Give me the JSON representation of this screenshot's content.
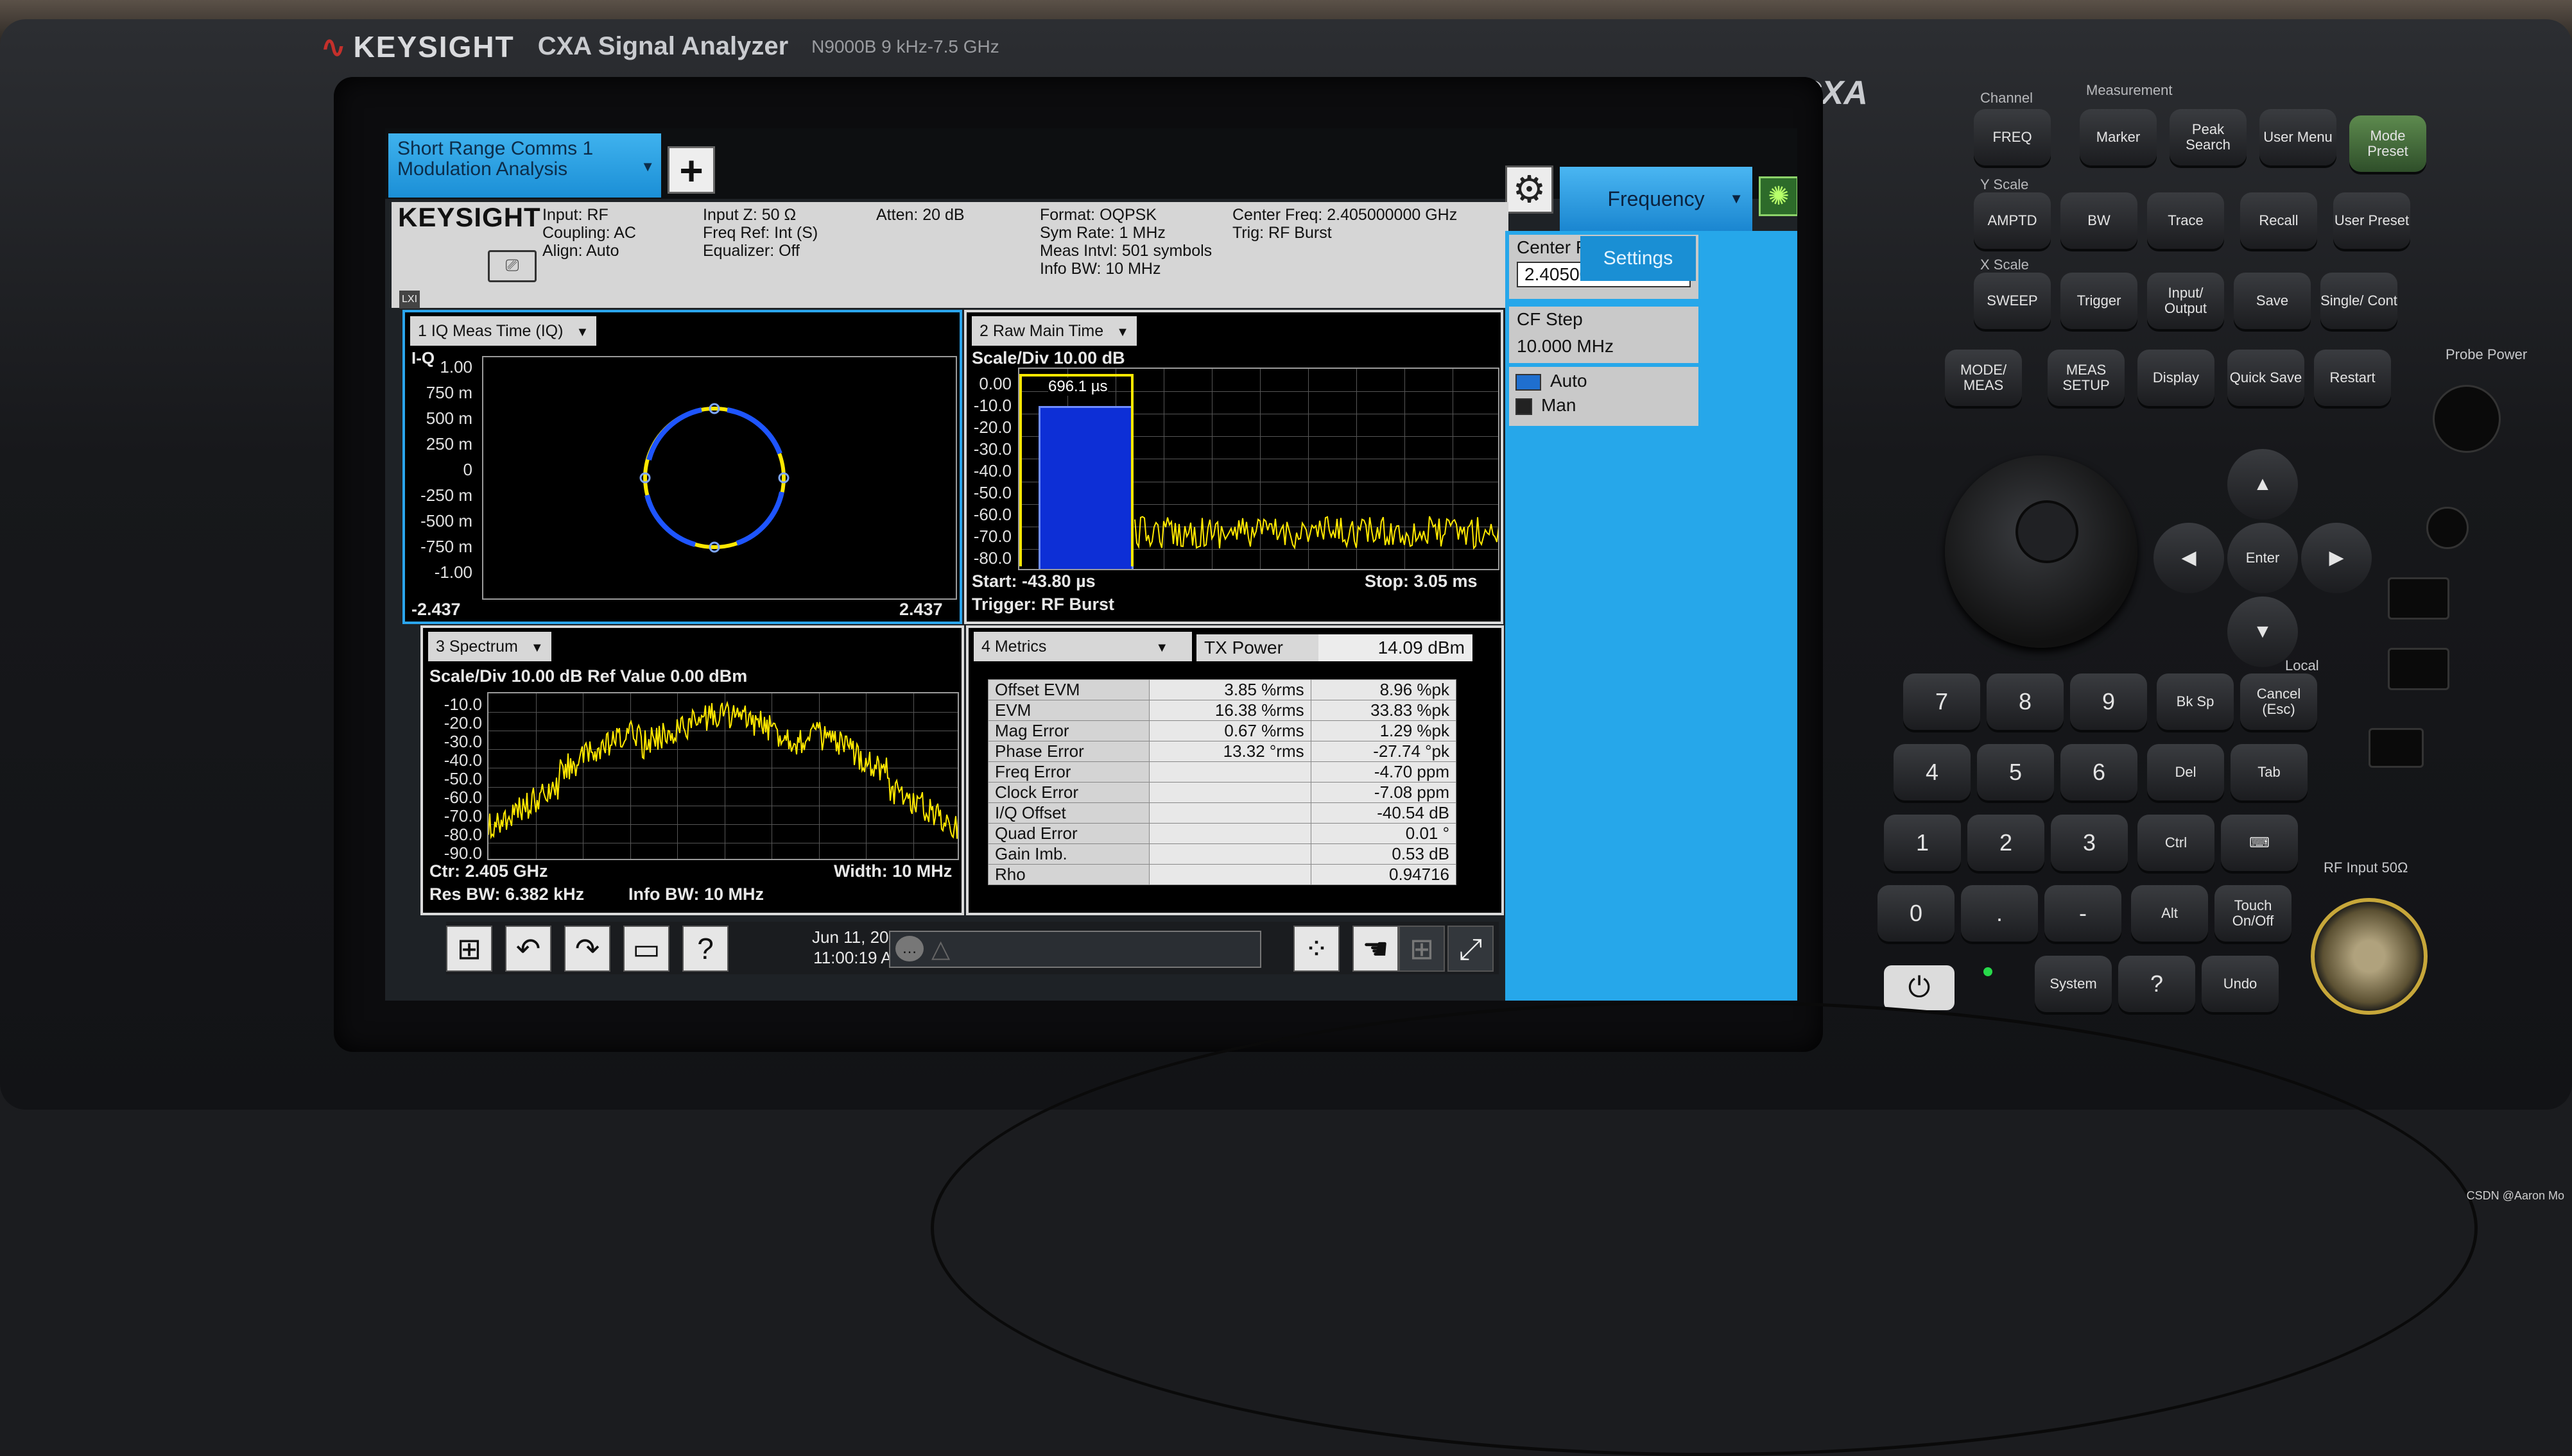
{
  "device": {
    "brand": "KEYSIGHT",
    "product": "CXA Signal Analyzer",
    "model_range": "N9000B 9 kHz-7.5 GHz",
    "model_short": "CXA"
  },
  "screen": {
    "mode_tab": {
      "line1": "Short Range Comms 1",
      "line2": "Modulation Analysis"
    },
    "add_tab": "+",
    "infobar": {
      "logo": "KEYSIGHT",
      "lxi": "LXI",
      "col1": [
        "Input: RF",
        "Coupling: AC",
        "Align: Auto"
      ],
      "col2": [
        "Input Z: 50 Ω",
        "Freq Ref: Int (S)",
        "Equalizer: Off"
      ],
      "col3": [
        "Atten: 20 dB"
      ],
      "col4": [
        "Format: OQPSK",
        "Sym Rate: 1 MHz",
        "Meas Intvl: 501 symbols",
        "Info BW: 10 MHz"
      ],
      "col5": [
        "Center Freq: 2.405000000 GHz",
        "Trig: RF Burst"
      ]
    },
    "panel1": {
      "title": "1 IQ Meas Time (IQ)",
      "axis_label": "I-Q",
      "y_ticks": [
        "1.00",
        "750 m",
        "500 m",
        "250 m",
        "0",
        "-250 m",
        "-500 m",
        "-750 m",
        "-1.00"
      ],
      "x_min": "-2.437",
      "x_max": "2.437"
    },
    "panel2": {
      "title": "2 Raw Main Time",
      "scale": "Scale/Div 10.00 dB",
      "y_ticks": [
        "0.00",
        "-10.0",
        "-20.0",
        "-30.0",
        "-40.0",
        "-50.0",
        "-60.0",
        "-70.0",
        "-80.0"
      ],
      "marker": "696.1 µs",
      "start": "Start: -43.80 µs",
      "stop": "Stop: 3.05 ms",
      "trigger": "Trigger: RF Burst"
    },
    "panel3": {
      "title": "3 Spectrum",
      "scale": "Scale/Div 10.00 dB Ref Value 0.00 dBm",
      "y_ticks": [
        "-10.0",
        "-20.0",
        "-30.0",
        "-40.0",
        "-50.0",
        "-60.0",
        "-70.0",
        "-80.0",
        "-90.0"
      ],
      "ctr": "Ctr: 2.405 GHz",
      "width": "Width: 10 MHz",
      "res_bw": "Res BW: 6.382 kHz",
      "info_bw": "Info BW: 10 MHz"
    },
    "panel4": {
      "title": "4 Metrics",
      "tx_power_label": "TX Power",
      "tx_power_value": "14.09 dBm",
      "rows": [
        {
          "label": "Offset EVM",
          "rms": "3.85 %rms",
          "pk": "8.96 %pk"
        },
        {
          "label": "EVM",
          "rms": "16.38 %rms",
          "pk": "33.83 %pk"
        },
        {
          "label": "Mag Error",
          "rms": "0.67 %rms",
          "pk": "1.29 %pk"
        },
        {
          "label": "Phase Error",
          "rms": "13.32 °rms",
          "pk": "-27.74 °pk"
        },
        {
          "label": "Freq Error",
          "rms": "",
          "pk": "-4.70 ppm"
        },
        {
          "label": "Clock Error",
          "rms": "",
          "pk": "-7.08 ppm"
        },
        {
          "label": "I/Q Offset",
          "rms": "",
          "pk": "-40.54 dB"
        },
        {
          "label": "Quad Error",
          "rms": "",
          "pk": "0.01 °"
        },
        {
          "label": "Gain Imb.",
          "rms": "",
          "pk": "0.53 dB"
        },
        {
          "label": "Rho",
          "rms": "",
          "pk": "0.94716"
        }
      ]
    },
    "side": {
      "menu": "Frequency",
      "settings_tab": "Settings",
      "center_freq_label": "Center Frequency",
      "center_freq_value": "2.405000000 GHz",
      "cf_step_label": "CF Step",
      "cf_step_value": "10.000 MHz",
      "auto": "Auto",
      "man": "Man"
    },
    "taskbar": {
      "date": "Jun 11, 2020",
      "time": "11:00:19 AM"
    }
  },
  "keys": {
    "channel_label": "Channel",
    "measurement_label": "Measurement",
    "yscale_label": "Y Scale",
    "xscale_label": "X Scale",
    "local_label": "Local",
    "probe_label": "Probe Power",
    "rf_input_label": "RF Input 50Ω",
    "freq": "FREQ",
    "marker": "Marker",
    "peak_search": "Peak Search",
    "user_menu": "User Menu",
    "mode_preset": "Mode Preset",
    "amptd": "AMPTD",
    "bw": "BW",
    "trace": "Trace",
    "recall": "Recall",
    "user_preset": "User Preset",
    "sweep": "SWEEP",
    "trigger": "Trigger",
    "input_output": "Input/ Output",
    "save": "Save",
    "single_cont": "Single/ Cont",
    "mode_meas": "MODE/ MEAS",
    "meas_setup": "MEAS SETUP",
    "display": "Display",
    "quick_save": "Quick Save",
    "restart": "Restart",
    "k7": "7",
    "k8": "8",
    "k9": "9",
    "k4": "4",
    "k5": "5",
    "k6": "6",
    "k1": "1",
    "k2": "2",
    "k3": "3",
    "k0": "0",
    "kdot": ".",
    "kminus": "-",
    "bksp": "Bk Sp",
    "cancel": "Cancel (Esc)",
    "del": "Del",
    "tab": "Tab",
    "ctrl": "Ctrl",
    "alt": "Alt",
    "touch": "Touch On/Off",
    "enter": "Enter",
    "system": "System",
    "help": "?",
    "undo": "Undo"
  },
  "watermark": "CSDN @Aaron Mo"
}
